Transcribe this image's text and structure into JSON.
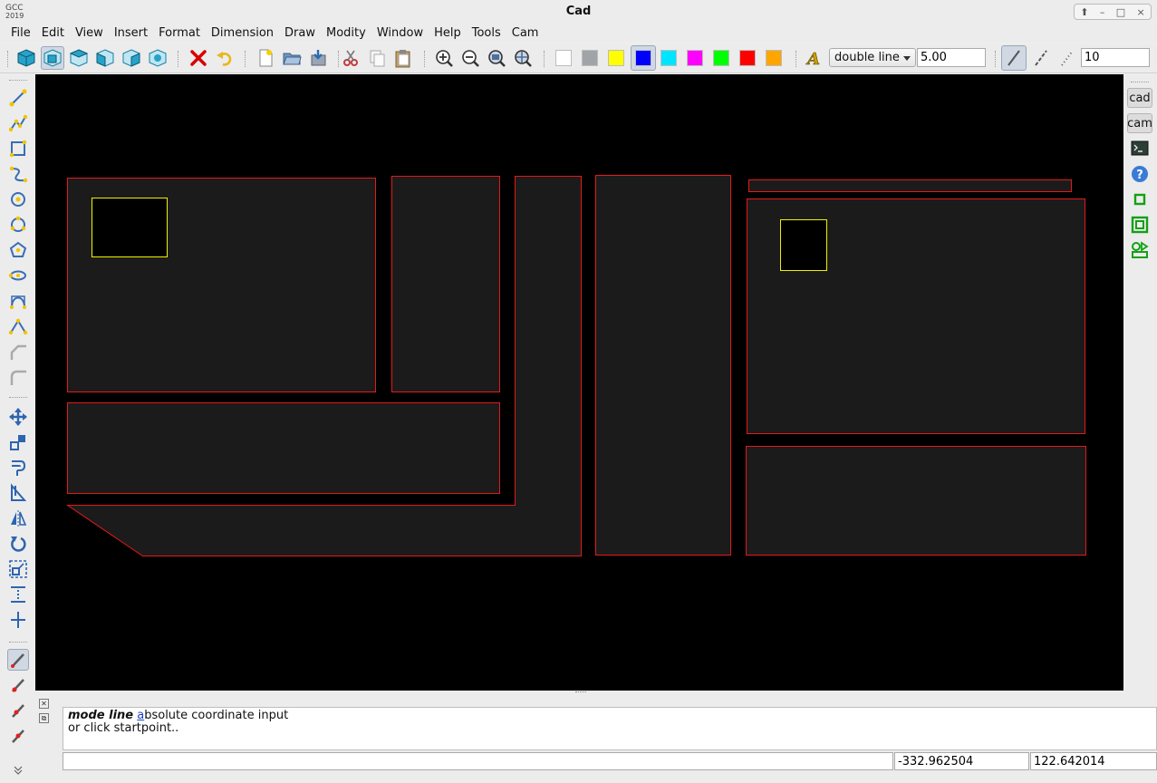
{
  "window": {
    "title": "Cad",
    "logo_line1": "GCC",
    "logo_line2": "2019",
    "controls": [
      "⬆",
      "–",
      "□",
      "×"
    ]
  },
  "menu": [
    "File",
    "Edit",
    "View",
    "Insert",
    "Format",
    "Dimension",
    "Draw",
    "Modity",
    "Window",
    "Help",
    "Tools",
    "Cam"
  ],
  "toolbar": {
    "view_buttons": [
      "view-3d-icon",
      "view-front-icon",
      "view-top-icon",
      "view-left-icon",
      "view-right-icon",
      "view-iso-icon"
    ],
    "edit_buttons": [
      "delete-icon",
      "undo-icon"
    ],
    "file_buttons": [
      "new-file-icon",
      "open-file-icon",
      "save-file-icon"
    ],
    "clipboard_buttons": [
      "cut-icon",
      "copy-icon",
      "paste-icon"
    ],
    "zoom_buttons": [
      "zoom-in-icon",
      "zoom-out-icon",
      "zoom-extents-icon",
      "zoom-window-icon"
    ],
    "colors": [
      "#ffffff",
      "#a0a4a8",
      "#ffff00",
      "#0000ff",
      "#00e5ff",
      "#ff00ff",
      "#00ff00",
      "#ff0000",
      "#ffa500"
    ],
    "selected_color": "#0000ff",
    "line_type": "double line",
    "line_width": "5.00",
    "line_buttons": [
      "solid-line-icon",
      "dash-line-icon",
      "dot-line-icon"
    ],
    "line_scale": "10"
  },
  "left_tools": [
    "line-icon",
    "polyline-icon",
    "rectangle-icon",
    "spline-icon",
    "circle-icon",
    "arc-icon",
    "polygon-icon",
    "ellipse-icon",
    "bezier-icon",
    "curve-icon",
    "fillet-icon",
    "chamfer-icon",
    "move-icon",
    "copy-objects-icon",
    "offset-icon",
    "trim-icon",
    "mirror-icon",
    "rotate-icon",
    "scale-icon",
    "break-icon",
    "extend-icon",
    "pick-icon",
    "snap-end-icon",
    "snap-mid-icon",
    "snap-near-icon",
    "expand-more-icon"
  ],
  "right_tabs": {
    "cad": "cad",
    "cam": "cam"
  },
  "right_tools": [
    "terminal-icon",
    "help-icon",
    "cam-small-square-icon",
    "cam-square-icon",
    "cam-nest-icon"
  ],
  "colors": {
    "canvas": "#000000",
    "shape_fill": "#1b1b1b",
    "shape_stroke": "#e31a1a",
    "hole_stroke": "#f0f000"
  },
  "command": {
    "mode": "mode line",
    "hotkey": "a",
    "rest_line1": "bsolute coordinate input",
    "line2": "or click startpoint..",
    "input_value": "",
    "coord_x": "-332.962504",
    "coord_y": "122.642014"
  }
}
